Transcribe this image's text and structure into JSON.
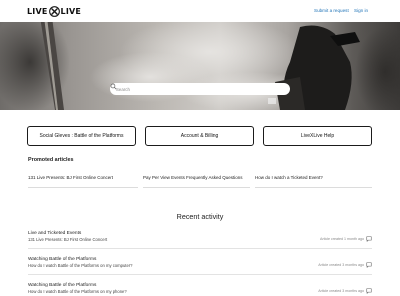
{
  "header": {
    "logo_left": "LIVE",
    "logo_right": "LIVE",
    "submit_request": "Submit a request",
    "sign_in": "Sign in"
  },
  "search": {
    "placeholder": "Search"
  },
  "categories": [
    {
      "label": "Social Gleves : Battle of the Platforms"
    },
    {
      "label": "Account & Billing"
    },
    {
      "label": "LiveXLive Help"
    }
  ],
  "promoted": {
    "title": "Promoted articles",
    "items": [
      {
        "label": "131 Live Presents: BJ First Online Concert"
      },
      {
        "label": "Pay Per View Events Frequently Asked Questions"
      },
      {
        "label": "How do I watch a Ticketed Event?"
      }
    ]
  },
  "recent": {
    "title": "Recent activity",
    "items": [
      {
        "title": "Live and Ticketed Events",
        "subtitle": "131 Live Presents: BJ First Online Concert",
        "meta": "Article created 1 month ago"
      },
      {
        "title": "Watching Battle of the Platforms",
        "subtitle": "How do I watch Battle of the Platforms on my computer?",
        "meta": "Article created 3 months ago"
      },
      {
        "title": "Watching Battle of the Platforms",
        "subtitle": "How do I watch Battle of the Platforms on my phone?",
        "meta": "Article created 3 months ago"
      }
    ]
  },
  "colors": {
    "link": "#1f73b7",
    "logo_accent": "#1a1a1a"
  },
  "icons": {
    "logo_mark": "x-logo-icon",
    "search": "search-icon",
    "comment": "comment-icon"
  }
}
